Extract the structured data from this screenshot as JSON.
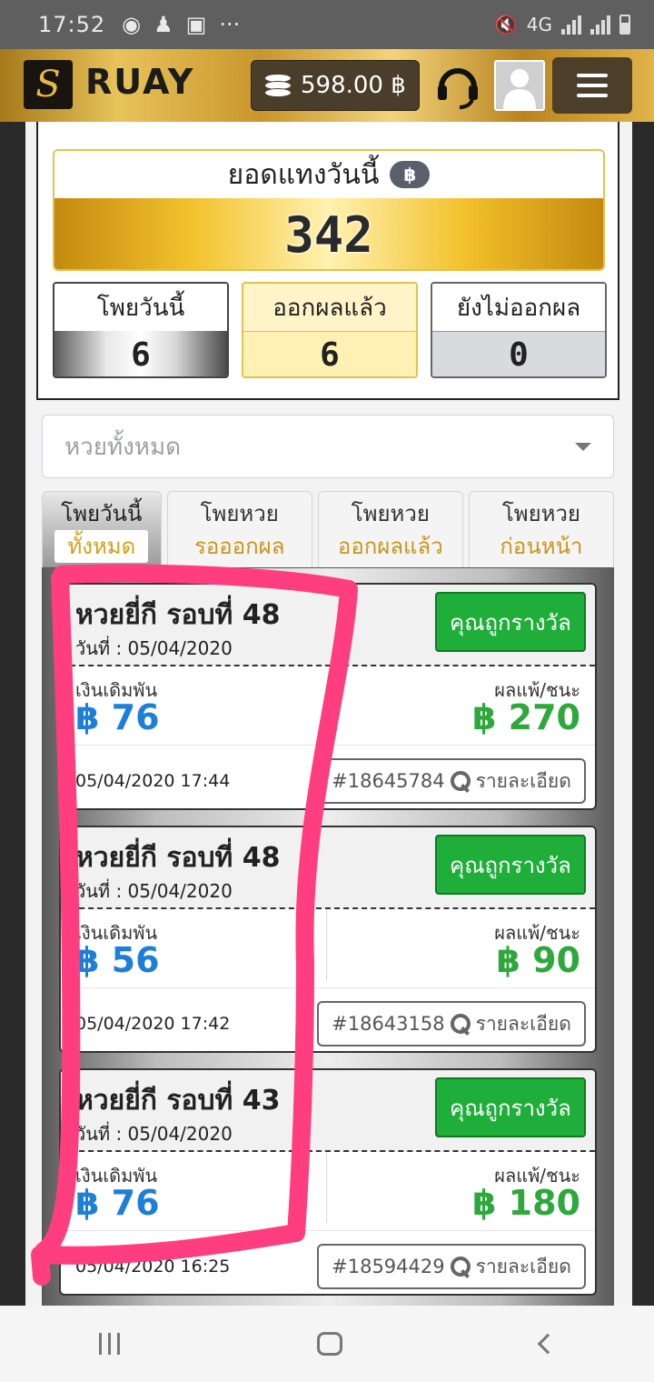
{
  "status_bar": {
    "time": "17:52",
    "network": "4G"
  },
  "header": {
    "logo_letter": "S",
    "brand": "RUAY",
    "balance": "598.00 ฿",
    "icons": [
      "coins-icon",
      "headset-icon",
      "user-icon",
      "menu-icon"
    ]
  },
  "summary": {
    "today_title": "ยอดแทงวันนี้",
    "currency_badge": "฿",
    "today_value": "342",
    "stats": [
      {
        "label": "โพยวันนี้",
        "value": "6"
      },
      {
        "label": "ออกผลแล้ว",
        "value": "6"
      },
      {
        "label": "ยังไม่ออกผล",
        "value": "0"
      }
    ]
  },
  "filter": {
    "placeholder": "หวยทั้งหมด"
  },
  "tabs": [
    {
      "line1": "โพยวันนี้",
      "line2": "ทั้งหมด",
      "active": true
    },
    {
      "line1": "โพยหวย",
      "line2": "รอออกผล",
      "active": false
    },
    {
      "line1": "โพยหวย",
      "line2": "ออกผลแล้ว",
      "active": false
    },
    {
      "line1": "โพยหวย",
      "line2": "ก่อนหน้า",
      "active": false
    }
  ],
  "tickets": [
    {
      "title": "หวยยี่กี รอบที่ 48",
      "date": "วันที่ : 05/04/2020",
      "status": "คุณถูกรางวัล",
      "bet_label": "เงินเดิมพัน",
      "bet": "฿ 76",
      "result_label": "ผลแพ้/ชนะ",
      "result": "฿ 270",
      "time": "05/04/2020 17:44",
      "ticket_id": "#18645784",
      "detail_label": "รายละเอียด"
    },
    {
      "title": "หวยยี่กี รอบที่ 48",
      "date": "วันที่ : 05/04/2020",
      "status": "คุณถูกรางวัล",
      "bet_label": "เงินเดิมพัน",
      "bet": "฿ 56",
      "result_label": "ผลแพ้/ชนะ",
      "result": "฿ 90",
      "time": "05/04/2020 17:42",
      "ticket_id": "#18643158",
      "detail_label": "รายละเอียด"
    },
    {
      "title": "หวยยี่กี รอบที่ 43",
      "date": "วันที่ : 05/04/2020",
      "status": "คุณถูกรางวัล",
      "bet_label": "เงินเดิมพัน",
      "bet": "฿ 76",
      "result_label": "ผลแพ้/ชนะ",
      "result": "฿ 180",
      "time": "05/04/2020 16:25",
      "ticket_id": "#18594429",
      "detail_label": "รายละเอียด"
    }
  ],
  "colors": {
    "accent_gold": "#e8c35a",
    "win_green": "#1fae3a",
    "bet_blue": "#1e7fd6",
    "highlight_pink": "#ff3d7f"
  }
}
